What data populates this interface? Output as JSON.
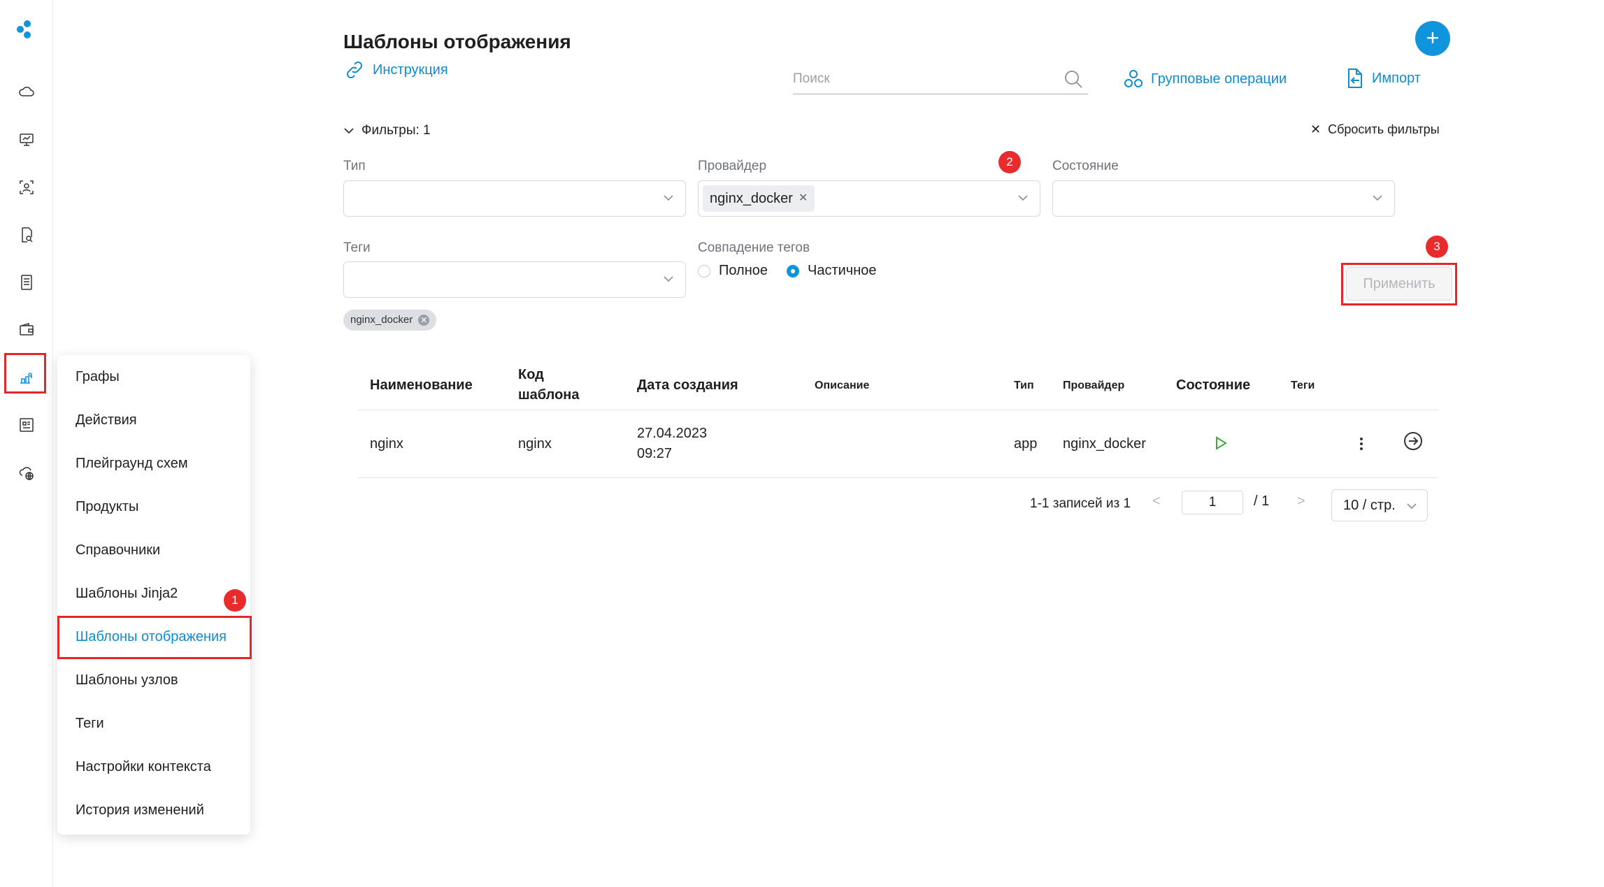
{
  "header": {
    "title": "Шаблоны отображения",
    "instruction_link": "Инструкция",
    "search_placeholder": "Поиск",
    "group_ops": "Групповые операции",
    "import": "Импорт",
    "add_button": "+"
  },
  "filters": {
    "toggle_label": "Фильтры: 1",
    "reset_label": "Сбросить фильтры",
    "type_label": "Тип",
    "provider_label": "Провайдер",
    "provider_chip": "nginx_docker",
    "state_label": "Состояние",
    "tags_label": "Теги",
    "tag_match_label": "Совпадение тегов",
    "radio_full": "Полное",
    "radio_partial": "Частичное",
    "apply": "Применить",
    "applied_tag": "nginx_docker"
  },
  "badges": {
    "b1": "1",
    "b2": "2",
    "b3": "3"
  },
  "menu": {
    "items": [
      "Графы",
      "Действия",
      "Плейграунд схем",
      "Продукты",
      "Справочники",
      "Шаблоны Jinja2",
      "Шаблоны отображения",
      "Шаблоны узлов",
      "Теги",
      "Настройки контекста",
      "История изменений"
    ],
    "active_index": 6
  },
  "table": {
    "headers": {
      "name": "Наименование",
      "code_line1": "Код",
      "code_line2": "шаблона",
      "date": "Дата создания",
      "description": "Описание",
      "type": "Тип",
      "provider": "Провайдер",
      "state": "Состояние",
      "tags": "Теги"
    },
    "rows": [
      {
        "name": "nginx",
        "code": "nginx",
        "date_line1": "27.04.2023",
        "date_line2": "09:27",
        "type": "app",
        "provider": "nginx_docker"
      }
    ]
  },
  "pagination": {
    "summary": "1-1 записей из 1",
    "prev": "<",
    "current": "1",
    "separator": "/  1",
    "next": ">",
    "page_size": "10 / стр."
  },
  "colors": {
    "accent": "#1095dd",
    "highlight": "#e5262a",
    "badge": "#e92b2b"
  }
}
